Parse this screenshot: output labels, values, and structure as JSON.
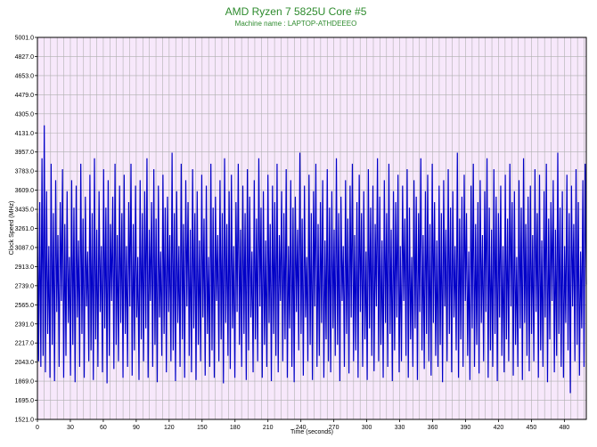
{
  "chart_data": {
    "type": "line",
    "title": "AMD Ryzen 7 5825U Core #5",
    "subtitle": "Machine name : LAPTOP-ATHDEEEO",
    "xlabel": "Time (seconds)",
    "ylabel": "Clock Speed (MHz)",
    "xlim": [
      0,
      500
    ],
    "ylim": [
      1521.0,
      5001.0
    ],
    "x_ticks": [
      0,
      30,
      60,
      90,
      120,
      150,
      180,
      210,
      240,
      270,
      300,
      330,
      360,
      390,
      420,
      450,
      480
    ],
    "y_ticks": [
      "1521.0",
      "1695.0",
      "1869.0",
      "2043.0",
      "2217.0",
      "2391.0",
      "2565.0",
      "2739.0",
      "2913.0",
      "3087.0",
      "3261.0",
      "3435.0",
      "3609.0",
      "3783.0",
      "3957.0",
      "4131.0",
      "4305.0",
      "4479.0",
      "4653.0",
      "4827.0",
      "5001.0"
    ],
    "grid": true,
    "background_color": "#f7e8fb",
    "grid_color": "#b0b0b0",
    "title_color": "#2e8b2e",
    "line_color": "#0000c8",
    "series": [
      {
        "values": [
          3400,
          2050,
          3500,
          2000,
          3900,
          2100,
          4200,
          1950,
          3600,
          2300,
          3100,
          1900,
          3850,
          2200,
          3400,
          1870,
          3700,
          2500,
          3200,
          2000,
          3500,
          2600,
          3800,
          1900,
          3300,
          2100,
          3600,
          2400,
          3000,
          1920,
          3700,
          2200,
          3450,
          1860,
          3650,
          2450,
          3150,
          2000,
          3850,
          2300,
          3350,
          1900,
          3550,
          2550,
          3050,
          2050,
          3750,
          2150,
          3400,
          1880,
          3900,
          2250,
          3250,
          2000,
          3600,
          2500,
          3100,
          1950,
          3800,
          2350,
          3450,
          1850,
          3700,
          2100,
          3300,
          2600,
          3550,
          1980,
          3850,
          2200,
          3200,
          2050,
          3650,
          2400,
          3400,
          1900,
          3750,
          2300,
          3100,
          2000,
          3500,
          2550,
          3850,
          1920,
          3300,
          2150,
          3650,
          2450,
          3000,
          1880,
          3700,
          2250,
          3400,
          2050,
          3600,
          2350,
          3900,
          1900,
          3250,
          2600,
          3500,
          2000,
          3800,
          2200,
          3350,
          1860,
          3650,
          2450,
          3050,
          2100,
          3750,
          2300,
          3450,
          1950,
          3550,
          2500,
          3200,
          2050,
          3950,
          2150,
          3400,
          1870,
          3600,
          2400,
          3100,
          2000,
          3850,
          2250,
          3300,
          1900,
          3700,
          2550,
          3500,
          2100,
          3250,
          1950,
          3800,
          2350,
          3400,
          1880,
          3600,
          2200,
          3150,
          2050,
          3750,
          2450,
          3350,
          1920,
          3650,
          2300,
          3000,
          2000,
          3850,
          2150,
          3450,
          1900,
          3550,
          2600,
          3200,
          2050,
          3700,
          2250,
          3400,
          1850,
          3900,
          2400,
          3300,
          2100,
          3600,
          1980,
          3750,
          2350,
          3100,
          1900,
          3500,
          2500,
          3850,
          2200,
          3250,
          2000,
          3650,
          2300,
          3400,
          1880,
          3800,
          2150,
          3550,
          2450,
          3050,
          1950,
          3700,
          2250,
          3350,
          2050,
          3900,
          2550,
          3450,
          1900,
          3600,
          2200,
          3150,
          2000,
          3750,
          2400,
          3300,
          1870,
          3650,
          2300,
          3500,
          2100,
          3850,
          1950,
          3200,
          2600,
          3600,
          2050,
          3400,
          2250,
          3800,
          1900,
          3100,
          2350,
          3700,
          2000,
          3450,
          1860,
          3550,
          2500,
          3250,
          2150,
          3950,
          2300,
          3350,
          1920,
          3650,
          2450,
          3000,
          2050,
          3750,
          2200,
          3400,
          1880,
          3600,
          2550,
          3850,
          2000,
          3300,
          2100,
          3500,
          2400,
          3700,
          1900,
          3150,
          2250,
          3800,
          2050,
          3450,
          1950,
          3600,
          2350,
          3250,
          2100,
          3900,
          2200,
          3400,
          1870,
          3550,
          2600,
          3100,
          2000,
          3700,
          2300,
          3350,
          1940,
          3650,
          2450,
          3850,
          2050,
          3200,
          2150,
          3500,
          1900,
          3750,
          2500,
          3400,
          2000,
          3600,
          2250,
          3050,
          1880,
          3800,
          2350,
          3450,
          2100,
          3650,
          1960,
          3300,
          2550,
          3900,
          2050,
          3550,
          2200,
          3150,
          1900,
          3700,
          2400,
          3400,
          2000,
          3850,
          2300,
          3250,
          1870,
          3600,
          2150,
          3500,
          2450,
          3750,
          1950,
          3100,
          2050,
          3650,
          2600,
          3350,
          2100,
          3800,
          1900,
          3450,
          2250,
          3000,
          2000,
          3700,
          2350,
          3550,
          1880,
          3400,
          2500,
          3900,
          2150,
          3200,
          1980,
          3600,
          2300,
          3750,
          2050,
          3300,
          1920,
          3850,
          2400,
          3500,
          2100,
          3150,
          2000,
          3650,
          2200,
          3400,
          1860,
          3700,
          2550,
          3250,
          2050,
          3800,
          2300,
          3450,
          1950,
          3600,
          2450,
          3100,
          2150,
          3950,
          1900,
          3350,
          2250,
          3550,
          2000,
          3750,
          2600,
          3400,
          2100,
          3050,
          1880,
          3650,
          2350,
          3850,
          2000,
          3300,
          2200,
          3500,
          1940,
          3700,
          2400,
          3200,
          2050,
          3600,
          2500,
          3900,
          1900,
          3450,
          2150,
          3250,
          2000,
          3800,
          2300,
          3550,
          1870,
          3400,
          2450,
          3650,
          2100,
          3100,
          1950,
          3750,
          2250,
          3350,
          2050,
          3850,
          2550,
          3500,
          1920,
          3600,
          2200,
          3000,
          2000,
          3700,
          2350,
          3450,
          1880,
          3900,
          2400,
          3300,
          2100,
          3550,
          1960,
          3650,
          2300,
          3200,
          2050,
          3800,
          2500,
          3400,
          1900,
          3750,
          2150,
          3150,
          2000,
          3600,
          2450,
          3850,
          1860,
          3350,
          2250,
          3500,
          2600,
          3700,
          1950,
          3250,
          2100,
          3950,
          2300,
          3450,
          2000,
          3600,
          1900,
          3100,
          2400,
          3750,
          2150,
          3400,
          1760,
          3650,
          2550,
          3300,
          2050,
          3800,
          2200,
          3500,
          1920,
          3050,
          2350,
          3700,
          2000,
          3850,
          2750
        ]
      }
    ]
  }
}
